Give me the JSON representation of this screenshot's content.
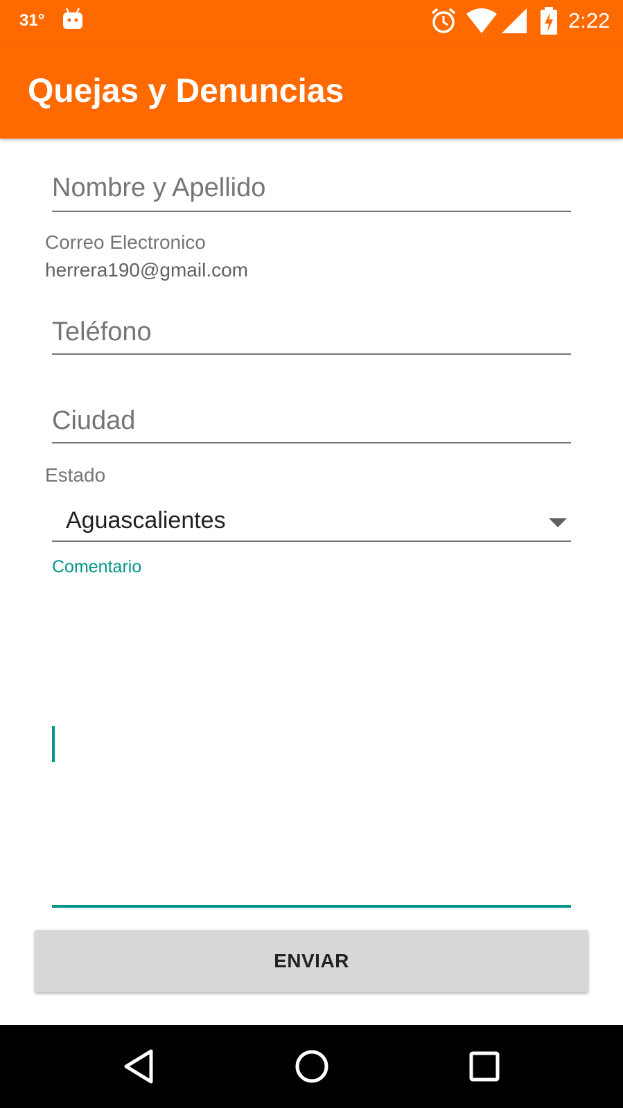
{
  "status_bar": {
    "temperature": "31°",
    "time": "2:22",
    "icons": [
      "android-icon",
      "alarm-icon",
      "wifi-icon",
      "signal-icon",
      "battery-charging-icon"
    ]
  },
  "app_bar": {
    "title": "Quejas y Denuncias",
    "color": "#ff6a00"
  },
  "form": {
    "name_placeholder": "Nombre y Apellido",
    "email_label": "Correo Electronico",
    "email_value": "herrera190@gmail.com",
    "phone_placeholder": "Teléfono",
    "city_placeholder": "Ciudad",
    "state_label": "Estado",
    "state_selected": "Aguascalientes",
    "comment_label": "Comentario",
    "comment_value": "",
    "submit_label": "ENVIAR",
    "accent_color": "#009688"
  },
  "nav_bar": {
    "icons": [
      "back-icon",
      "home-icon",
      "recents-icon"
    ]
  }
}
